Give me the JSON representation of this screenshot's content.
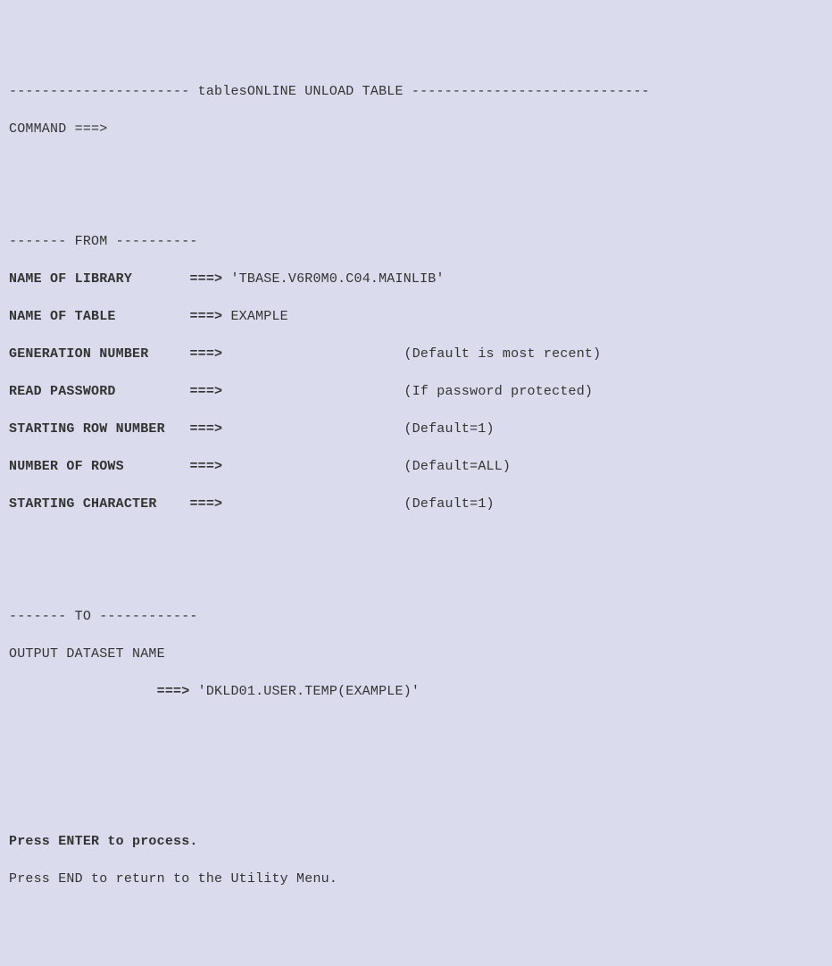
{
  "header": {
    "title_left": "---------------------- ",
    "title_text": "tablesONLINE UNLOAD TABLE",
    "title_right": " -----------------------------"
  },
  "command": {
    "label": "COMMAND ===>",
    "value": ""
  },
  "sections": {
    "from_divider": "------- FROM ----------",
    "to_divider": "------- TO ------------"
  },
  "fields": {
    "library": {
      "label": "NAME OF LIBRARY",
      "value": "'TBASE.V6R0M0.C04.MAINLIB'",
      "hint": ""
    },
    "table": {
      "label": "NAME OF TABLE",
      "value": "EXAMPLE",
      "hint": ""
    },
    "generation": {
      "label": "GENERATION NUMBER",
      "value": "",
      "hint": "(Default is most recent)"
    },
    "password": {
      "label": "READ PASSWORD",
      "value": "",
      "hint": "(If password protected)"
    },
    "start_row": {
      "label": "STARTING ROW NUMBER",
      "value": "",
      "hint": "(Default=1)"
    },
    "num_rows": {
      "label": "NUMBER OF ROWS",
      "value": "",
      "hint": "(Default=ALL)"
    },
    "start_char": {
      "label": "STARTING CHARACTER",
      "value": "",
      "hint": "(Default=1)"
    }
  },
  "output": {
    "label": "OUTPUT DATASET NAME",
    "value": "'DKLD01.USER.TEMP(EXAMPLE)'"
  },
  "footer": {
    "enter": "Press ENTER to process.",
    "end": "Press END to return to the Utility Menu."
  },
  "arrow": "===>"
}
